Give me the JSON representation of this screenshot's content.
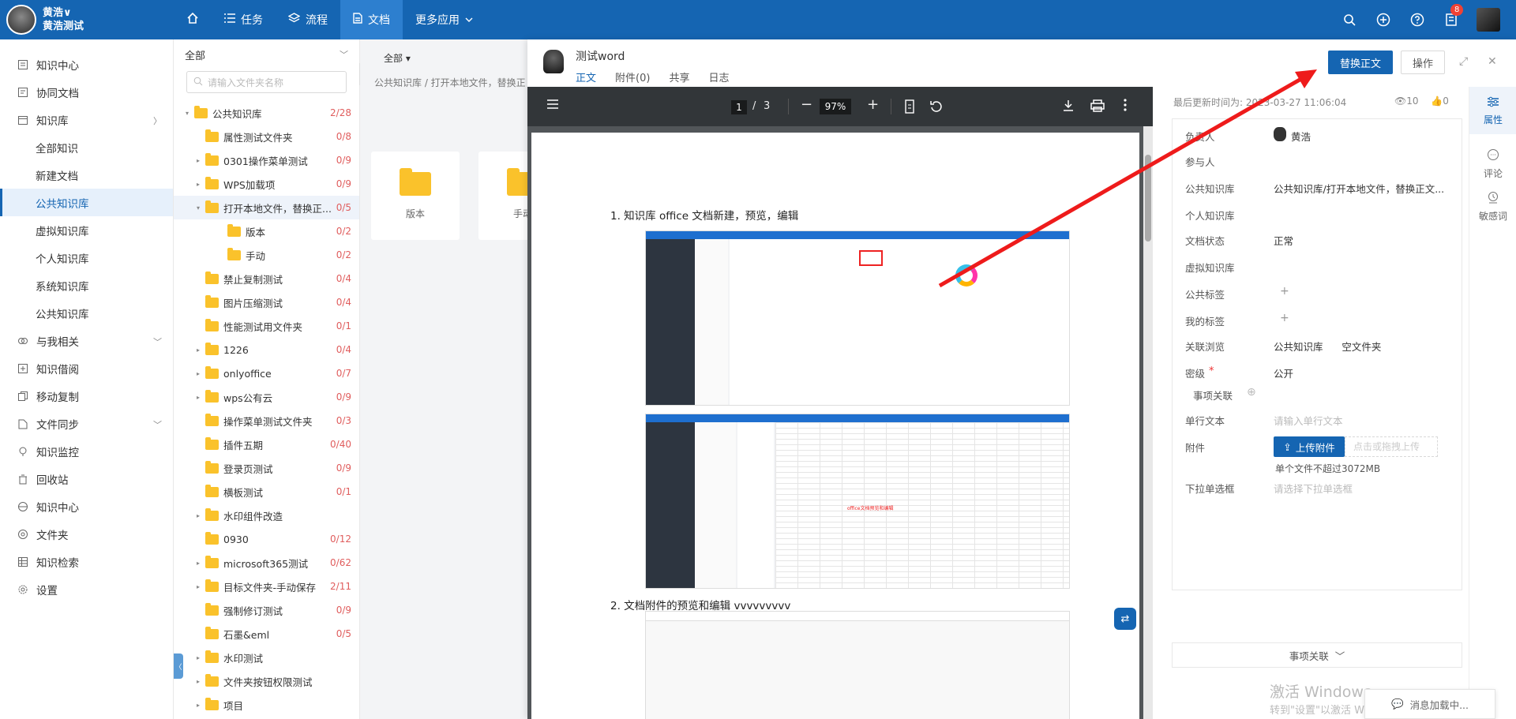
{
  "user": {
    "name": "黄浩∨",
    "org": "黄浩测试"
  },
  "nav": {
    "home_icon": "home-icon",
    "items": [
      {
        "label": "任务",
        "icon": "list-icon"
      },
      {
        "label": "流程",
        "icon": "layers-icon"
      },
      {
        "label": "文档",
        "icon": "document-icon"
      },
      {
        "label": "更多应用",
        "icon": "chevron-down-icon"
      }
    ]
  },
  "top": {
    "notification_count": "8"
  },
  "sidebar": {
    "items": [
      {
        "label": "知识中心"
      },
      {
        "label": "协同文档"
      },
      {
        "label": "知识库"
      },
      {
        "label": "全部知识"
      },
      {
        "label": "新建文档"
      },
      {
        "label": "公共知识库"
      },
      {
        "label": "虚拟知识库"
      },
      {
        "label": "个人知识库"
      },
      {
        "label": "系统知识库"
      },
      {
        "label": "公共知识库"
      },
      {
        "label": "与我相关"
      },
      {
        "label": "知识借阅"
      },
      {
        "label": "移动复制"
      },
      {
        "label": "文件同步"
      },
      {
        "label": "知识监控"
      },
      {
        "label": "回收站"
      },
      {
        "label": "知识中心"
      },
      {
        "label": "文件夹"
      },
      {
        "label": "知识检索"
      },
      {
        "label": "设置"
      }
    ]
  },
  "tree": {
    "header": "全部",
    "search_placeholder": "请输入文件夹名称",
    "nodes": [
      {
        "label": "公共知识库",
        "count": "2/28"
      },
      {
        "label": "属性测试文件夹",
        "count": "0/8"
      },
      {
        "label": "0301操作菜单测试",
        "count": "0/9"
      },
      {
        "label": "WPS加载项",
        "count": "0/9"
      },
      {
        "label": "打开本地文件，替换正...",
        "count": "0/5"
      },
      {
        "label": "版本",
        "count": "0/2"
      },
      {
        "label": "手动",
        "count": "0/2"
      },
      {
        "label": "禁止复制测试",
        "count": "0/4"
      },
      {
        "label": "图片压缩测试",
        "count": "0/4"
      },
      {
        "label": "性能测试用文件夹",
        "count": "0/1"
      },
      {
        "label": "1226",
        "count": "0/4"
      },
      {
        "label": "onlyoffice",
        "count": "0/7"
      },
      {
        "label": "wps公有云",
        "count": "0/9"
      },
      {
        "label": "操作菜单测试文件夹",
        "count": "0/3"
      },
      {
        "label": "插件五期",
        "count": "0/40"
      },
      {
        "label": "登录页测试",
        "count": "0/9"
      },
      {
        "label": "横板测试",
        "count": "0/1"
      },
      {
        "label": "水印组件改造",
        "count": ""
      },
      {
        "label": "0930",
        "count": "0/12"
      },
      {
        "label": "microsoft365测试",
        "count": "0/62"
      },
      {
        "label": "目标文件夹-手动保存",
        "count": "2/11"
      },
      {
        "label": "强制修订测试",
        "count": "0/9"
      },
      {
        "label": "石墨&eml",
        "count": "0/5"
      },
      {
        "label": "水印测试",
        "count": ""
      },
      {
        "label": "文件夹按钮权限测试",
        "count": ""
      },
      {
        "label": "项目",
        "count": ""
      }
    ]
  },
  "list": {
    "filter": "全部 ▾",
    "path": "公共知识库 / 打开本地文件，替换正",
    "tiles": [
      {
        "label": "版本"
      },
      {
        "label": "手动"
      }
    ]
  },
  "doc": {
    "title": "测试word",
    "tabs": [
      {
        "label": "正文"
      },
      {
        "label": "附件(0)"
      },
      {
        "label": "共享"
      },
      {
        "label": "日志"
      }
    ],
    "replace_button": "替换正文",
    "action_button": "操作"
  },
  "viewer": {
    "page_current": "1",
    "page_sep": "/",
    "page_total": "3",
    "zoom": "97%",
    "line1": "1.   知识库 office 文档新建，预览，编辑",
    "line2": "2.   文档附件的预览和编辑 vvvvvvvvv",
    "shot2_caption": "office文档预览和编辑"
  },
  "props": {
    "updated_label": "最后更新时间为: 2023-03-27 11:06:04",
    "views": "10",
    "likes": "0",
    "owner_label": "负责人",
    "owner_value": "黄浩",
    "rows": [
      {
        "label": "参与人",
        "value": ""
      },
      {
        "label": "公共知识库",
        "value": "公共知识库/打开本地文件，替换正文..."
      },
      {
        "label": "个人知识库",
        "value": ""
      },
      {
        "label": "文档状态",
        "value": "正常"
      },
      {
        "label": "虚拟知识库",
        "value": ""
      },
      {
        "label": "公共标签",
        "value": ""
      },
      {
        "label": "我的标签",
        "value": ""
      },
      {
        "label": "关联浏览",
        "value": "公共知识库      空文件夹"
      },
      {
        "label": "密级",
        "value": "公开"
      },
      {
        "label": "事项关联",
        "value": ""
      },
      {
        "label": "单行文本",
        "value": "请输入单行文本"
      },
      {
        "label": "附件",
        "value": ""
      },
      {
        "label": "下拉单选框",
        "value": "请选择下拉单选框"
      }
    ],
    "upload_button": "上传附件",
    "upload_drop": "点击或拖拽上传",
    "upload_limit": "单个文件不超过3072MB",
    "assoc_bar": "事项关联",
    "watermark_1": "激活 Windows",
    "watermark_2": "转到\"设置\"以激活 Windows。"
  },
  "rail": [
    {
      "label": "属性"
    },
    {
      "label": "评论"
    },
    {
      "label": "敏感词"
    }
  ],
  "toast": "消息加载中..."
}
